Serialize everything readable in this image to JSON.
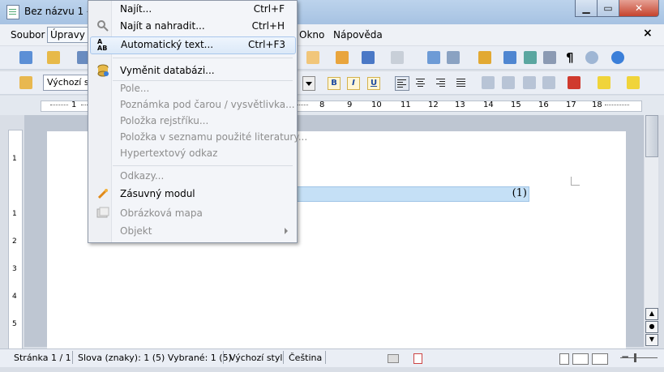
{
  "window": {
    "title": "Bez názvu 1 - L"
  },
  "menubar": {
    "items": [
      "Soubor",
      "Úpravy",
      "Okno",
      "Nápověda"
    ]
  },
  "toolbar": {
    "style_value": "Výchozí st"
  },
  "ruler": {
    "labels": [
      "1",
      "8",
      "9",
      "10",
      "11",
      "12",
      "13",
      "14",
      "15",
      "16",
      "17",
      "18"
    ]
  },
  "vruler": {
    "labels": [
      "1",
      "1",
      "2",
      "3",
      "4",
      "5"
    ]
  },
  "document": {
    "highlight_text": "(1)"
  },
  "dropdown": {
    "items": [
      {
        "label": "Najít...",
        "shortcut": "Ctrl+F",
        "disabled": false,
        "icon": "none"
      },
      {
        "label": "Najít a nahradit...",
        "shortcut": "Ctrl+H",
        "disabled": false,
        "icon": "find-replace-icon"
      },
      {
        "label": "Automatický text...",
        "shortcut": "Ctrl+F3",
        "disabled": false,
        "icon": "autotext-icon",
        "highlighted": true
      },
      {
        "label": "Vyměnit databázi...",
        "shortcut": "",
        "disabled": false,
        "icon": "database-icon"
      },
      {
        "label": "Pole...",
        "shortcut": "",
        "disabled": true
      },
      {
        "label": "Poznámka pod čarou / vysvětlivka...",
        "shortcut": "",
        "disabled": true
      },
      {
        "label": "Položka rejstříku...",
        "shortcut": "",
        "disabled": true
      },
      {
        "label": "Položka v seznamu použité literatury...",
        "shortcut": "",
        "disabled": true
      },
      {
        "label": "Hypertextový odkaz",
        "shortcut": "",
        "disabled": true
      },
      {
        "label": "Odkazy...",
        "shortcut": "",
        "disabled": true
      },
      {
        "label": "Zásuvný modul",
        "shortcut": "",
        "disabled": false,
        "icon": "plugin-icon"
      },
      {
        "label": "Obrázková mapa",
        "shortcut": "",
        "disabled": true,
        "icon": "image-map-icon"
      },
      {
        "label": "Objekt",
        "shortcut": "",
        "disabled": true,
        "submenu": true
      }
    ]
  },
  "statusbar": {
    "page": "Stránka 1 / 1",
    "words": "Slova (znaky): 1 (5) Vybrané: 1 (5)",
    "style": "Výchozí styl",
    "language": "Čeština"
  },
  "colors": {
    "highlight": "#c5e0f6",
    "titlebar": "#a6c2e2",
    "close": "#c5432d"
  }
}
